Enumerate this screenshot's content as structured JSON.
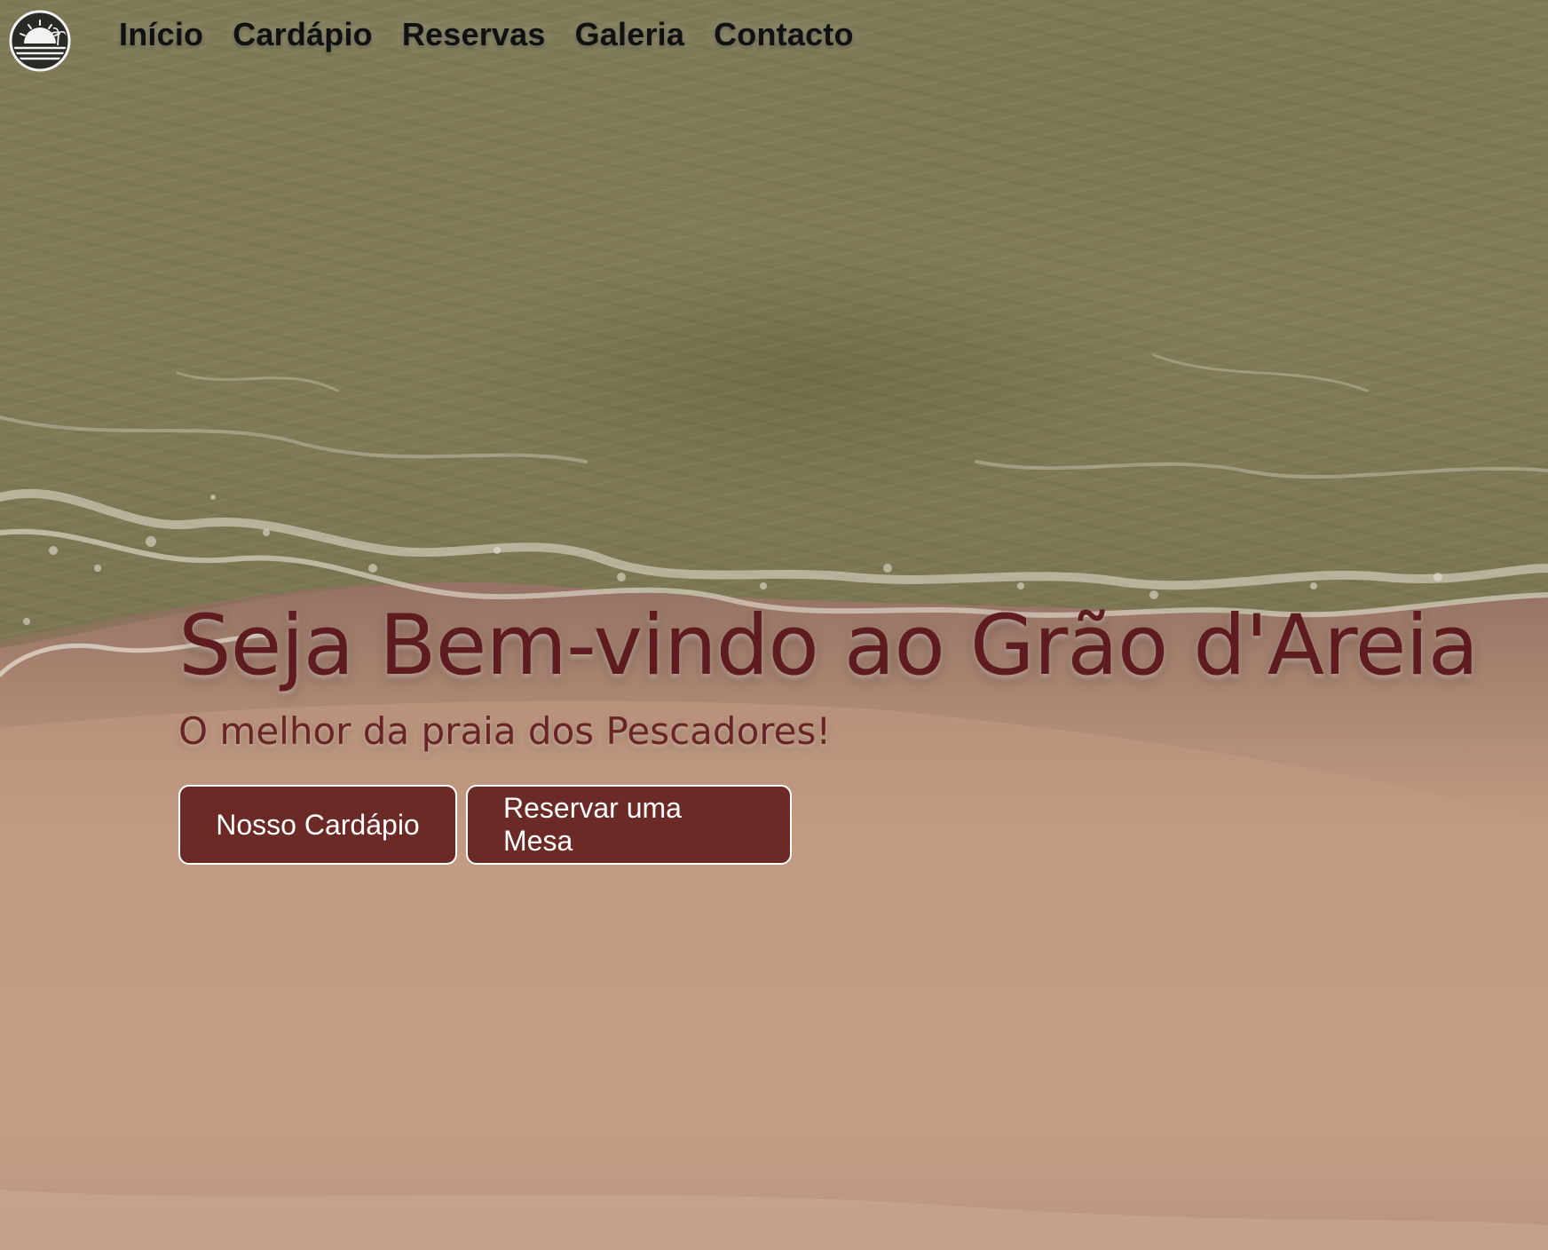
{
  "nav": {
    "logo_alt": "Grão d'Areia logo",
    "links": [
      {
        "label": "Início"
      },
      {
        "label": "Cardápio"
      },
      {
        "label": "Reservas"
      },
      {
        "label": "Galeria"
      },
      {
        "label": "Contacto"
      }
    ]
  },
  "hero": {
    "title": "Seja Bem-vindo ao Grão d'Areia",
    "subtitle": "O melhor da praia dos Pescadores!",
    "buttons": {
      "menu_label": "Nosso Cardápio",
      "reserve_label": "Reservar uma Mesa"
    }
  },
  "colors": {
    "title": "#5e1c1f",
    "button_bg": "#6c2a26",
    "button_border": "#ffffff",
    "nav_text": "#111111"
  },
  "icons": {
    "logo": "sunset-beach-logo-icon"
  }
}
